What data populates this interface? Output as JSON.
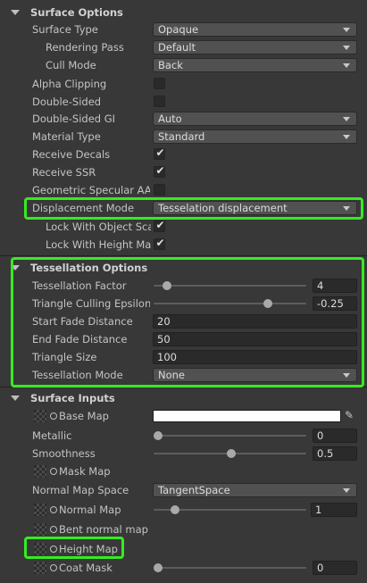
{
  "surface_options": {
    "title": "Surface Options",
    "surface_type": {
      "label": "Surface Type",
      "value": "Opaque"
    },
    "rendering_pass": {
      "label": "Rendering Pass",
      "value": "Default"
    },
    "cull_mode": {
      "label": "Cull Mode",
      "value": "Back"
    },
    "alpha_clipping": {
      "label": "Alpha Clipping",
      "checked": false
    },
    "double_sided": {
      "label": "Double-Sided",
      "checked": false
    },
    "double_sided_gi": {
      "label": "Double-Sided GI",
      "value": "Auto"
    },
    "material_type": {
      "label": "Material Type",
      "value": "Standard"
    },
    "receive_decals": {
      "label": "Receive Decals",
      "checked": true
    },
    "receive_ssr": {
      "label": "Receive SSR",
      "checked": true
    },
    "geometric_specular_aa": {
      "label": "Geometric Specular AA",
      "checked": false
    },
    "displacement_mode": {
      "label": "Displacement Mode",
      "value": "Tesselation displacement"
    },
    "lock_object_scale": {
      "label": "Lock With Object Sca",
      "checked": true
    },
    "lock_height_map": {
      "label": "Lock With Height Map",
      "checked": true
    }
  },
  "tessellation_options": {
    "title": "Tessellation Options",
    "factor": {
      "label": "Tessellation Factor",
      "value": "4",
      "fraction": 0.06
    },
    "culling_epsilon": {
      "label": "Triangle Culling Epsilon",
      "value": "-0.25",
      "fraction": 0.75
    },
    "start_fade": {
      "label": "Start Fade Distance",
      "value": "20"
    },
    "end_fade": {
      "label": "End Fade Distance",
      "value": "50"
    },
    "triangle_size": {
      "label": "Triangle Size",
      "value": "100"
    },
    "mode": {
      "label": "Tessellation Mode",
      "value": "None"
    }
  },
  "surface_inputs": {
    "title": "Surface Inputs",
    "base_map": {
      "label": "Base Map"
    },
    "metallic": {
      "label": "Metallic",
      "value": "0",
      "fraction": 0.0
    },
    "smoothness": {
      "label": "Smoothness",
      "value": "0.5",
      "fraction": 0.5
    },
    "mask_map": {
      "label": "Mask Map"
    },
    "normal_map_space": {
      "label": "Normal Map Space",
      "value": "TangentSpace"
    },
    "normal_map": {
      "label": "Normal Map",
      "value": "1",
      "fraction": 0.13
    },
    "bent_normal_map": {
      "label": "Bent normal map"
    },
    "height_map": {
      "label": "Height Map"
    },
    "coat_mask": {
      "label": "Coat Mask",
      "value": "0",
      "fraction": 0.0
    }
  },
  "colors": {
    "highlight": "#37ea22",
    "background": "#383838"
  }
}
